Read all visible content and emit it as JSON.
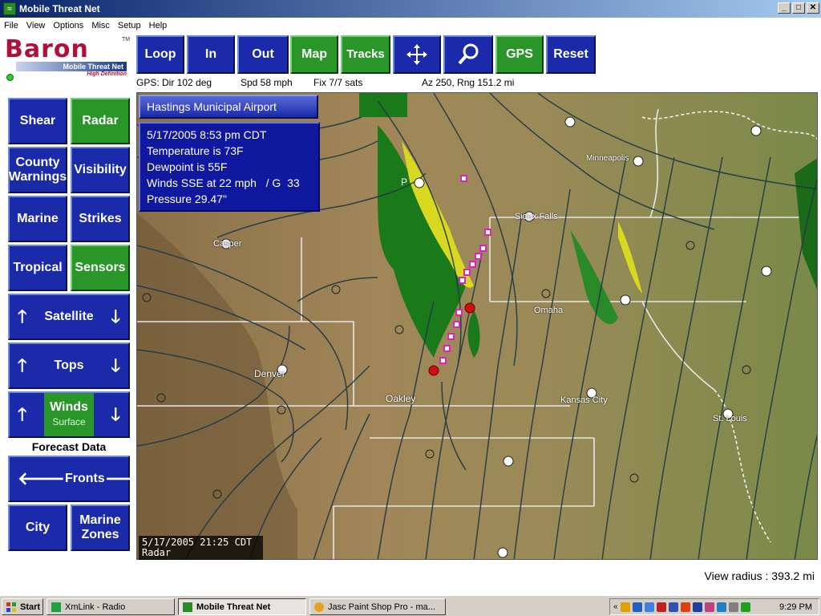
{
  "window": {
    "title": "Mobile Threat Net"
  },
  "menu": [
    "File",
    "View",
    "Options",
    "Misc",
    "Setup",
    "Help"
  ],
  "logo": {
    "brand": "Baron",
    "tagline": "Mobile Threat Net",
    "sub": "High Definition",
    "tm": "TM"
  },
  "toolbar": {
    "loop": "Loop",
    "in": "In",
    "out": "Out",
    "map": "Map",
    "tracks": "Tracks",
    "gps": "GPS",
    "reset": "Reset"
  },
  "gps": {
    "dir": "GPS: Dir 102 deg",
    "spd": "Spd 58 mph",
    "fix": "Fix 7/7 sats",
    "az": "Az 250, Rng 151.2 mi"
  },
  "sidebar": {
    "shear": "Shear",
    "radar": "Radar",
    "county_warnings": "County Warnings",
    "visibility": "Visibility",
    "marine": "Marine",
    "strikes": "Strikes",
    "tropical": "Tropical",
    "sensors": "Sensors",
    "satellite": "Satellite",
    "tops": "Tops",
    "winds": "Winds",
    "winds_sub": "Surface",
    "forecast_heading": "Forecast Data",
    "fronts": "Fronts",
    "city": "City",
    "marine_zones": "Marine Zones"
  },
  "popup": {
    "station": "Hastings Municipal Airport",
    "lines": [
      "5/17/2005 8:53 pm CDT",
      "Temperature is 73F",
      "Dewpoint is 55F",
      "Winds SSE at 22 mph   / G  33",
      "Pressure 29.47\""
    ]
  },
  "map_labels": {
    "city1": "P",
    "city2": "Sioux Falls",
    "city3": "Minneapolis",
    "city4": "Casper",
    "city5": "Omaha",
    "city6": "Denver",
    "city7": "Oakley",
    "city8": "Kansas City",
    "city9": "St. Louis"
  },
  "map_stamp": {
    "time": "5/17/2005 21:25 CDT",
    "layer": "Radar"
  },
  "view_radius": "View radius : 393.2 mi",
  "taskbar": {
    "start": "Start",
    "tasks": [
      "XmLink - Radio",
      "Mobile Threat Net",
      "Jasc Paint Shop Pro - ma..."
    ],
    "clock": "9:29 PM"
  },
  "colors": {
    "button_blue": "#1a2aa8",
    "button_green": "#2a962a",
    "brand": "#b0103a"
  }
}
